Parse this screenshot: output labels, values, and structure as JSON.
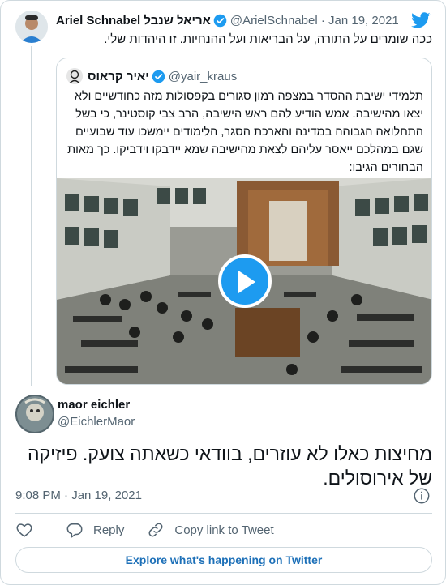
{
  "parent_tweet": {
    "author_name": "Ariel Schnabel אריאל שנבל",
    "handle": "@ArielSchnabel",
    "date": "Jan 19, 2021",
    "text": "ככה שומרים על התורה, על הבריאות ועל ההנחיות. זו היהדות שלי."
  },
  "quoted_tweet": {
    "author_name": "יאיר קראוס",
    "handle": "@yair_kraus",
    "text": "תלמידי ישיבת ההסדר במצפה רמון סגורים בקפסולות מזה כחודשיים ולא יצאו מהישיבה. אמש הודיע להם ראש הישיבה, הרב צבי קוסטינר, כי בשל התחלואה הגבוהה במדינה והארכת הסגר, הלימודים יימשכו עוד שבועיים שגם במהלכם ייאסר עליהם לצאת מהישיבה שמא יידבקו וידביקו. כך מאות הבחורים הגיבו:"
  },
  "main_tweet": {
    "author_name": "maor eichler",
    "handle": "@EichlerMaor",
    "text": "מחיצות כאלו לא עוזרים, בוודאי כשאתה צועק. פיזיקה של אירוסולים.",
    "timestamp": "9:08 PM · Jan 19, 2021"
  },
  "actions": {
    "reply_label": "Reply",
    "copy_link_label": "Copy link to Tweet"
  },
  "explore_label": "Explore what's happening on Twitter",
  "colors": {
    "accent": "#1d9bf0",
    "link": "#1d70b8",
    "muted": "#536471",
    "border": "#cfd9de"
  },
  "icons": [
    "twitter-logo-icon",
    "verified-badge-icon",
    "play-icon",
    "info-icon",
    "heart-icon",
    "reply-icon",
    "link-icon"
  ]
}
